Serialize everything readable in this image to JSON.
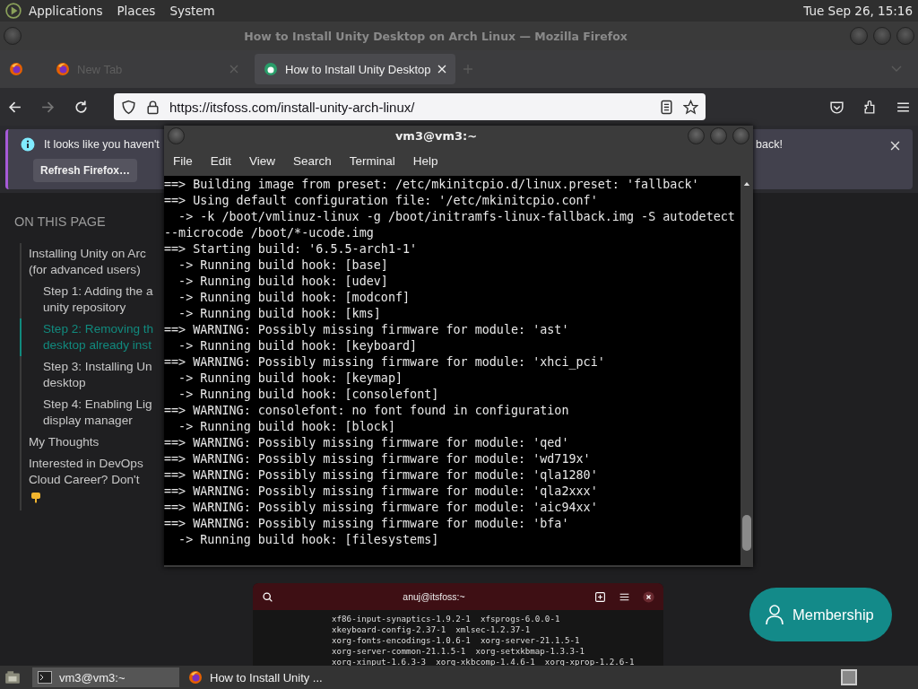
{
  "top_panel": {
    "menus": [
      "Applications",
      "Places",
      "System"
    ],
    "clock": "Tue Sep 26, 15:16"
  },
  "firefox": {
    "title": "How to Install Unity Desktop on Arch Linux — Mozilla Firefox",
    "tabs": [
      {
        "label": "New Tab",
        "selected": false
      },
      {
        "label": "How to Install Unity Desktop",
        "selected": true
      }
    ],
    "nav_buttons": [
      {
        "kind": "back",
        "disabled": false
      },
      {
        "kind": "forward",
        "disabled": true
      },
      {
        "kind": "reload",
        "disabled": false
      }
    ],
    "url": "https://itsfoss.com/install-unity-arch-linux/"
  },
  "notification": {
    "text_start": "It looks like you haven't",
    "text_end": "back!",
    "button": "Refresh Firefox…"
  },
  "toc": {
    "heading": "ON THIS PAGE",
    "items": [
      {
        "text": "Installing Unity on Arc\n(for advanced users)",
        "selected": false,
        "children": [
          {
            "text": "Step 1: Adding the a\nunity repository",
            "selected": false
          },
          {
            "text": "Step 2: Removing th\ndesktop already inst",
            "selected": true
          },
          {
            "text": "Step 3: Installing Un\ndesktop",
            "selected": false
          },
          {
            "text": "Step 4: Enabling Lig\ndisplay manager",
            "selected": false
          }
        ]
      },
      {
        "text": "My Thoughts",
        "selected": false
      },
      {
        "text": "Interested in DevOps\nCloud Career? Don't",
        "selected": false
      }
    ]
  },
  "terminal": {
    "title": "vm3@vm3:~",
    "menus": [
      "File",
      "Edit",
      "View",
      "Search",
      "Terminal",
      "Help"
    ],
    "lines": [
      "==> Building image from preset: /etc/mkinitcpio.d/linux.preset: 'fallback'",
      "==> Using default configuration file: '/etc/mkinitcpio.conf'",
      "  -> -k /boot/vmlinuz-linux -g /boot/initramfs-linux-fallback.img -S autodetect",
      "--microcode /boot/*-ucode.img",
      "==> Starting build: '6.5.5-arch1-1'",
      "  -> Running build hook: [base]",
      "  -> Running build hook: [udev]",
      "  -> Running build hook: [modconf]",
      "  -> Running build hook: [kms]",
      "==> WARNING: Possibly missing firmware for module: 'ast'",
      "  -> Running build hook: [keyboard]",
      "==> WARNING: Possibly missing firmware for module: 'xhci_pci'",
      "  -> Running build hook: [keymap]",
      "  -> Running build hook: [consolefont]",
      "==> WARNING: consolefont: no font found in configuration",
      "  -> Running build hook: [block]",
      "==> WARNING: Possibly missing firmware for module: 'qed'",
      "==> WARNING: Possibly missing firmware for module: 'wd719x'",
      "==> WARNING: Possibly missing firmware for module: 'qla1280'",
      "==> WARNING: Possibly missing firmware for module: 'qla2xxx'",
      "==> WARNING: Possibly missing firmware for module: 'aic94xx'",
      "==> WARNING: Possibly missing firmware for module: 'bfa'",
      "  -> Running build hook: [filesystems]"
    ]
  },
  "article_image": {
    "title": "anuj@itsfoss:~",
    "lines": [
      "xf86-input-synaptics-1.9.2-1  xfsprogs-6.0.0-1",
      "xkeyboard-config-2.37-1  xmlsec-1.2.37-1",
      "xorg-fonts-encodings-1.0.6-1  xorg-server-21.1.5-1",
      "xorg-server-common-21.1.5-1  xorg-setxkbmap-1.3.3-1",
      "xorg-xinput-1.6.3-3  xorg-xkbcomp-1.4.6-1  xorg-xprop-1.2.6-1"
    ]
  },
  "membership_button": "Membership",
  "taskbar": {
    "tasks": [
      {
        "kind": "terminal",
        "label": "vm3@vm3:~",
        "selected": true
      },
      {
        "kind": "browser",
        "label": "How to Install Unity ...",
        "selected": false
      }
    ]
  }
}
